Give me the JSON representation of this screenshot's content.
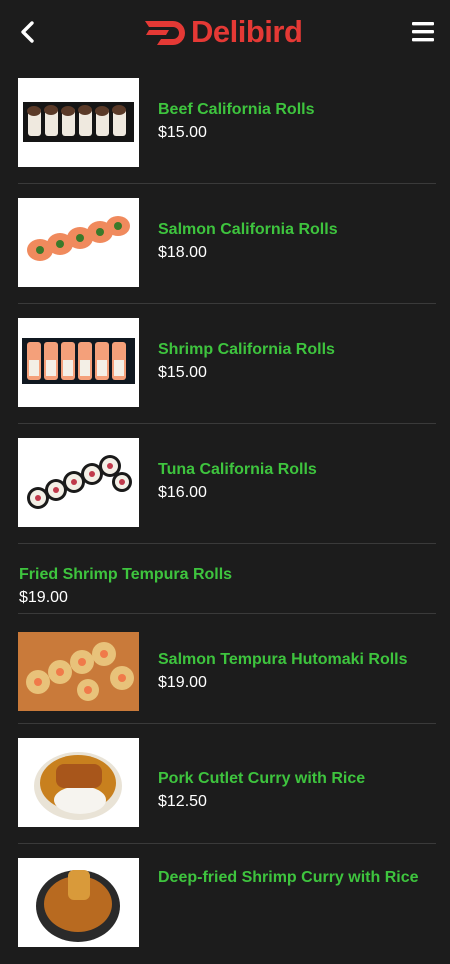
{
  "header": {
    "brand_name": "Delibird",
    "brand_color": "#e53935",
    "back_icon": "chevron-left-icon",
    "menu_icon": "hamburger-menu-icon"
  },
  "colors": {
    "item_name": "#3ec43e",
    "price": "#ffffff",
    "background": "#1c1c1c"
  },
  "menu_items": [
    {
      "name": "Beef California Rolls",
      "price": "$15.00",
      "image": "beef-rolls-image"
    },
    {
      "name": "Salmon California Rolls",
      "price": "$18.00",
      "image": "salmon-rolls-image"
    },
    {
      "name": "Shrimp California Rolls",
      "price": "$15.00",
      "image": "shrimp-rolls-image"
    },
    {
      "name": "Tuna California Rolls",
      "price": "$16.00",
      "image": "tuna-rolls-image"
    },
    {
      "name": "Fried Shrimp Tempura Rolls",
      "price": "$19.00"
    },
    {
      "name": "Salmon Tempura Hutomaki Rolls",
      "price": "$19.00",
      "image": "tempura-rolls-image"
    },
    {
      "name": "Pork Cutlet Curry with Rice",
      "price": "$12.50",
      "image": "curry-rice-image"
    },
    {
      "name": "Deep-fried Shrimp Curry with Rice",
      "price": "",
      "image": "shrimp-curry-image"
    }
  ]
}
